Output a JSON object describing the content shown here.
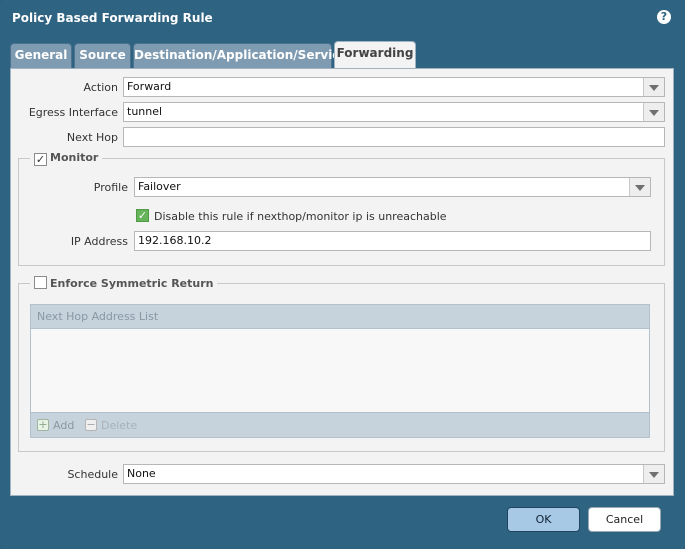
{
  "dialog": {
    "title": "Policy Based Forwarding Rule",
    "help_icon": "question-icon"
  },
  "tabs": [
    {
      "label": "General",
      "active": false
    },
    {
      "label": "Source",
      "active": false
    },
    {
      "label": "Destination/Application/Service",
      "active": false
    },
    {
      "label": "Forwarding",
      "active": true
    }
  ],
  "form": {
    "action": {
      "label": "Action",
      "value": "Forward"
    },
    "egress": {
      "label": "Egress Interface",
      "value": "tunnel"
    },
    "next_hop": {
      "label": "Next Hop",
      "value": ""
    }
  },
  "monitor": {
    "legend": "Monitor",
    "checked": true,
    "profile": {
      "label": "Profile",
      "value": "Failover"
    },
    "disable_rule": {
      "label": "Disable this rule if nexthop/monitor ip is unreachable",
      "checked": true
    },
    "ip": {
      "label": "IP Address",
      "value": "192.168.10.2"
    }
  },
  "symmetric": {
    "legend": "Enforce Symmetric Return",
    "checked": false,
    "list_header": "Next Hop Address List",
    "add_label": "Add",
    "delete_label": "Delete"
  },
  "schedule": {
    "label": "Schedule",
    "value": "None"
  },
  "buttons": {
    "ok": "OK",
    "cancel": "Cancel"
  },
  "colors": {
    "frame": "#2f6382",
    "panel": "#f3f3f3",
    "tab_inactive": "#7e9bb1",
    "ok_button": "#a7c9e5"
  }
}
